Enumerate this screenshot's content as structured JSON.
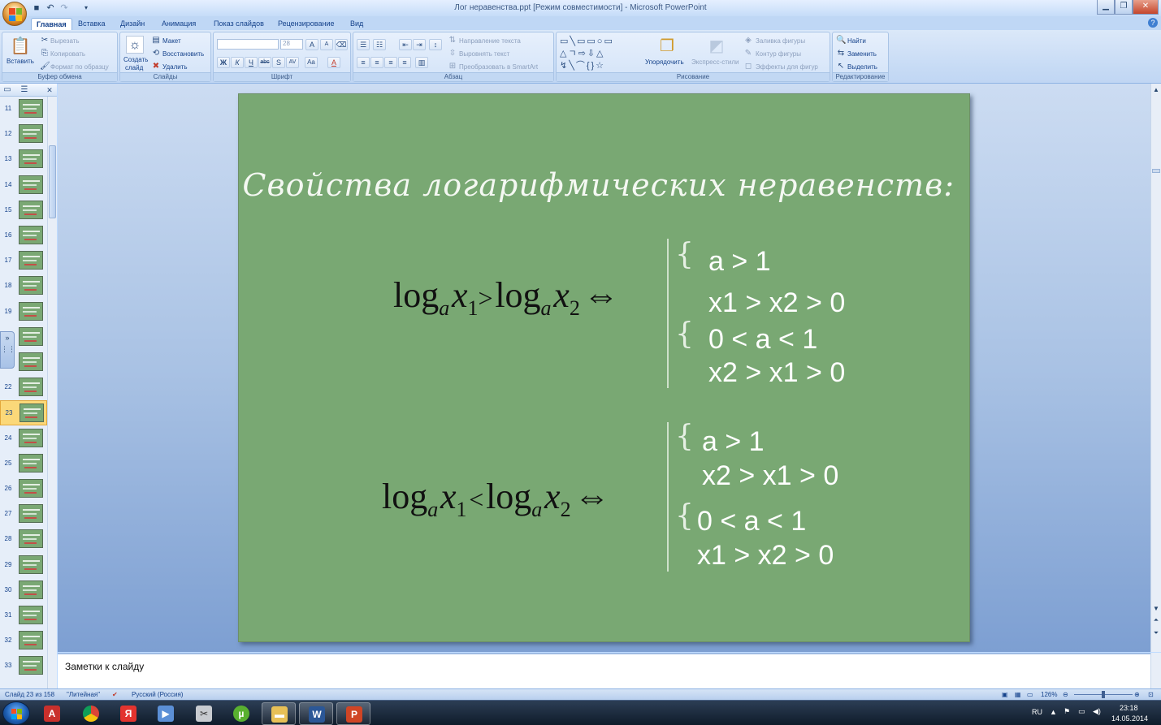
{
  "window": {
    "title": "Лог неравенства.ppt [Режим совместимости] - Microsoft PowerPoint",
    "controls": [
      "minimize",
      "maximize",
      "close"
    ]
  },
  "tabs": [
    "Главная",
    "Вставка",
    "Дизайн",
    "Анимация",
    "Показ слайдов",
    "Рецензирование",
    "Вид"
  ],
  "ribbon": {
    "clipboard": {
      "label": "Буфер обмена",
      "paste": "Вставить",
      "cut": "Вырезать",
      "copy": "Копировать",
      "format_painter": "Формат по образцу"
    },
    "slides": {
      "label": "Слайды",
      "new_slide_1": "Создать",
      "new_slide_2": "слайд",
      "layout": "Макет",
      "reset": "Восстановить",
      "delete": "Удалить"
    },
    "font": {
      "label": "Шрифт",
      "font_name": "",
      "font_size": "28"
    },
    "paragraph": {
      "label": "Абзац",
      "text_direction": "Направление текста",
      "align_text": "Выровнять текст",
      "smartart": "Преобразовать в SmartArt"
    },
    "drawing": {
      "label": "Рисование",
      "arrange": "Упорядочить",
      "quick_styles": "Экспресс-стили",
      "shape_fill": "Заливка фигуры",
      "shape_outline": "Контур фигуры",
      "shape_effects": "Эффекты для фигур"
    },
    "editing": {
      "label": "Редактирование",
      "find": "Найти",
      "replace": "Заменить",
      "select": "Выделить"
    }
  },
  "slide_panel": {
    "selected": "23",
    "numbers": [
      "11",
      "12",
      "13",
      "14",
      "15",
      "16",
      "17",
      "18",
      "19",
      "",
      "",
      "22",
      "23",
      "24",
      "25",
      "26",
      "27",
      "28",
      "29",
      "30",
      "31",
      "32",
      "33"
    ]
  },
  "slide": {
    "title": "Свойства логарифмических неравенств:",
    "formula1": {
      "log": "log",
      "base": "a",
      "x": "x",
      "sub1": "1",
      "sub2": "2",
      "relation": ">",
      "equiv": "⇔"
    },
    "formula2": {
      "log": "log",
      "base": "a",
      "x": "x",
      "sub1": "1",
      "sub2": "2",
      "relation": "<",
      "equiv": "⇔"
    },
    "conditions1": [
      "a > 1",
      "x1 > x2 > 0",
      "0 < a < 1",
      "x2 > x1 > 0"
    ],
    "conditions2": [
      "a > 1",
      "x2 > x1 > 0",
      "0 < a < 1",
      "x1 > x2 > 0"
    ]
  },
  "notes": {
    "placeholder": "Заметки к слайду"
  },
  "status": {
    "slide_info": "Слайд 23 из 158",
    "theme": "\"Литейная\"",
    "language": "Русский (Россия)",
    "zoom": "126%"
  },
  "taskbar": {
    "lang": "RU",
    "time": "23:18",
    "date": "14.05.2014"
  }
}
